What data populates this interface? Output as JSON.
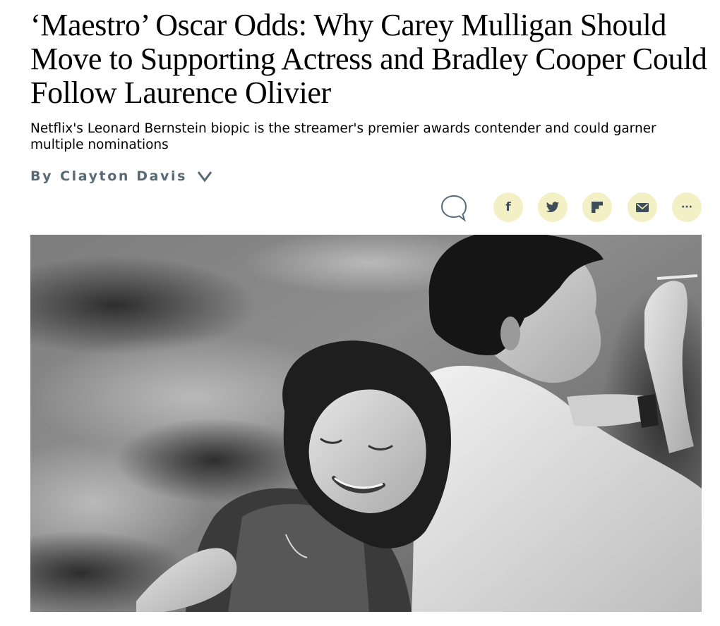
{
  "article": {
    "headline": "‘Maestro’ Oscar Odds: Why Carey Mulligan Should Move to Supporting Actress and Bradley Cooper Could Follow Laurence Olivier",
    "dek": "Netflix's Leonard Bernstein biopic is the streamer's premier awards contender and could garner multiple nominations",
    "byline_prefix": "By",
    "author": "Clayton Davis"
  },
  "share": {
    "items": [
      {
        "icon": "comment-icon"
      },
      {
        "icon": "facebook-icon",
        "glyph": "f"
      },
      {
        "icon": "twitter-icon"
      },
      {
        "icon": "flipboard-icon"
      },
      {
        "icon": "email-icon"
      },
      {
        "icon": "more-icon",
        "glyph": "···"
      }
    ],
    "button_color": "#f4f0c6",
    "icon_color": "#3e4e57"
  },
  "hero_image": {
    "style": "black-and-white photograph"
  },
  "colors": {
    "byline": "#586a75",
    "headline": "#000000"
  }
}
